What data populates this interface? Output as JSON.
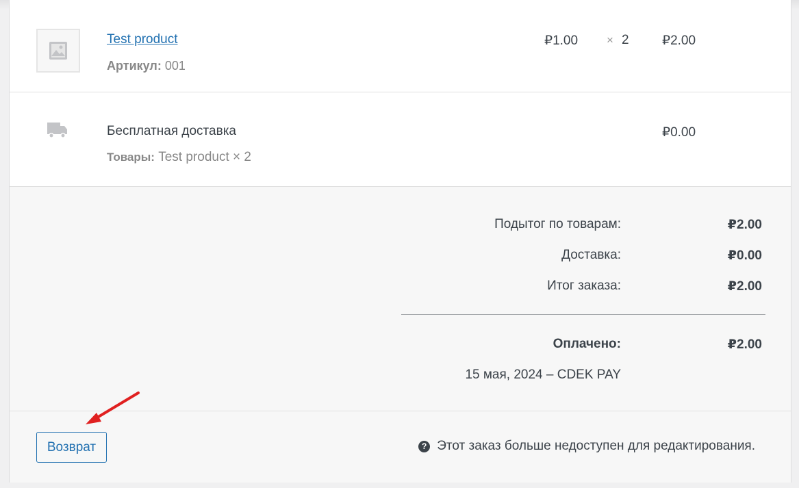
{
  "item": {
    "name": "Test product",
    "sku_label": "Артикул:",
    "sku_value": "001",
    "cost": "₽1.00",
    "qty_sign": "×",
    "qty": "2",
    "total": "₽2.00"
  },
  "shipping": {
    "title": "Бесплатная доставка",
    "items_label": "Товары:",
    "items_value": "Test product × 2",
    "total": "₽0.00"
  },
  "totals": {
    "subtotal_label": "Подытог по товарам:",
    "subtotal_value": "₽2.00",
    "shipping_label": "Доставка:",
    "shipping_value": "₽0.00",
    "order_total_label": "Итог заказа:",
    "order_total_value": "₽2.00",
    "paid_label": "Оплачено:",
    "paid_value": "₽2.00",
    "paid_date": "15 мая, 2024 – CDEK PAY"
  },
  "actions": {
    "refund_label": "Возврат",
    "help_icon_glyph": "?",
    "notice_text": "Этот заказ больше недоступен для редактирования."
  },
  "colors": {
    "link": "#2271b1",
    "annotation_arrow": "#e02020"
  }
}
